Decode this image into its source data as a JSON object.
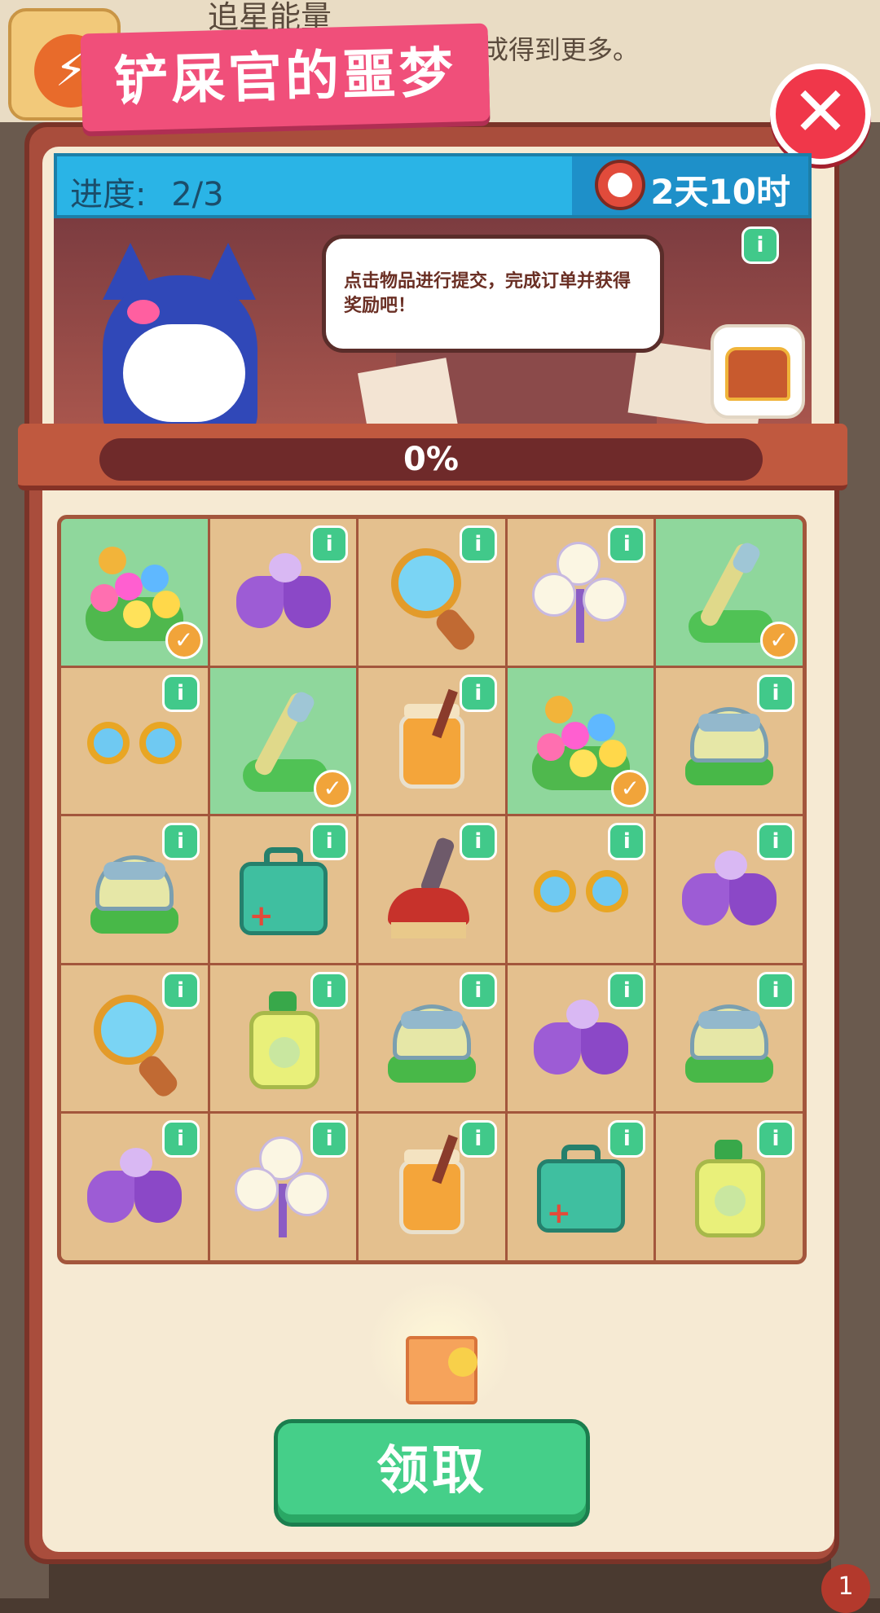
{
  "background": {
    "hud_title": "追星能量",
    "hud_subtitle": "合成得到更多。"
  },
  "event": {
    "title": "铲屎官的噩梦",
    "progress_label": "进度:",
    "progress_value": "2/3",
    "timer": "2天10时",
    "speech": "点击物品进行提交，完成订单并获得奖励吧！",
    "percent_label": "0%",
    "percent_value": 0
  },
  "icons": {
    "close": "close-icon",
    "info": "info-icon",
    "check": "check-icon",
    "clock": "clock-icon",
    "chest": "treasure-chest-icon",
    "gift": "gift-box-icon"
  },
  "info_glyph": "i",
  "check_glyph": "✓",
  "close_glyph": "✕",
  "grid": {
    "rows": [
      [
        {
          "item": "flower-bed",
          "done": true
        },
        {
          "item": "moth",
          "done": false
        },
        {
          "item": "magnifying-glass",
          "done": false
        },
        {
          "item": "dandelion",
          "done": false
        },
        {
          "item": "broom-grass",
          "done": true
        }
      ],
      [
        {
          "item": "glasses",
          "done": false
        },
        {
          "item": "broom-grass",
          "done": true
        },
        {
          "item": "honey-jar",
          "done": false
        },
        {
          "item": "flower-bed",
          "done": true
        },
        {
          "item": "helmet-grass",
          "done": false
        }
      ],
      [
        {
          "item": "helmet-grass",
          "done": false
        },
        {
          "item": "first-aid-kit",
          "done": false
        },
        {
          "item": "plunger",
          "done": false
        },
        {
          "item": "glasses",
          "done": false
        },
        {
          "item": "moth",
          "done": false
        }
      ],
      [
        {
          "item": "magnifying-glass",
          "done": false
        },
        {
          "item": "soap-bottle",
          "done": false
        },
        {
          "item": "helmet-grass",
          "done": false
        },
        {
          "item": "moth",
          "done": false
        },
        {
          "item": "helmet-grass",
          "done": false
        }
      ],
      [
        {
          "item": "moth",
          "done": false
        },
        {
          "item": "dandelion",
          "done": false
        },
        {
          "item": "honey-jar",
          "done": false
        },
        {
          "item": "first-aid-kit",
          "done": false
        },
        {
          "item": "soap-bottle",
          "done": false
        }
      ]
    ]
  },
  "claim_button": "领取",
  "corner_badge": "1",
  "colors": {
    "done_cell": "#8fd79c",
    "empty_cell": "#e4c08e",
    "claim_button": "#45cf89",
    "title_tag": "#f04f7a"
  }
}
